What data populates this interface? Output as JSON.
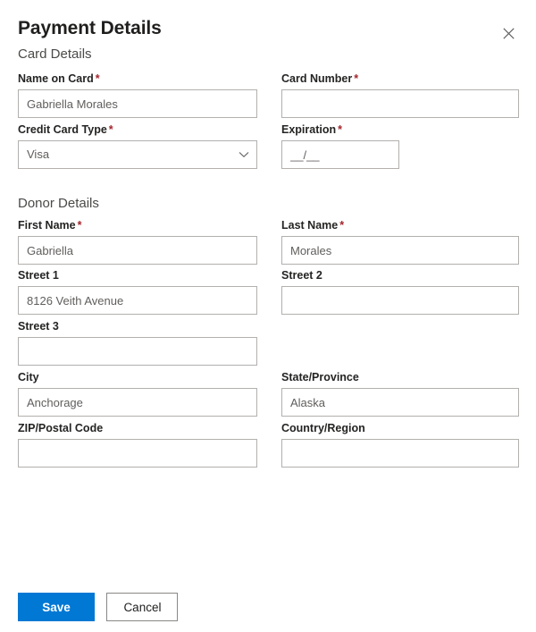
{
  "dialog": {
    "title": "Payment Details",
    "close_icon": "close-icon"
  },
  "sections": {
    "card": {
      "heading": "Card Details"
    },
    "donor": {
      "heading": "Donor Details"
    }
  },
  "fields": {
    "name_on_card": {
      "label": "Name on Card",
      "required": "*",
      "value": "Gabriella Morales",
      "placeholder": ""
    },
    "card_number": {
      "label": "Card Number",
      "required": "*",
      "value": "",
      "placeholder": ""
    },
    "card_type": {
      "label": "Credit Card Type",
      "required": "*",
      "value": "Visa",
      "chevron_icon": "chevron-down-icon"
    },
    "expiration": {
      "label": "Expiration",
      "required": "*",
      "value": "__/__",
      "placeholder": "__/__"
    },
    "first_name": {
      "label": "First Name",
      "required": "*",
      "value": "Gabriella",
      "placeholder": ""
    },
    "last_name": {
      "label": "Last Name",
      "required": "*",
      "value": "Morales",
      "placeholder": ""
    },
    "street1": {
      "label": "Street 1",
      "required": "",
      "value": "8126 Veith Avenue",
      "placeholder": ""
    },
    "street2": {
      "label": "Street 2",
      "required": "",
      "value": "",
      "placeholder": ""
    },
    "street3": {
      "label": "Street 3",
      "required": "",
      "value": "",
      "placeholder": ""
    },
    "city": {
      "label": "City",
      "required": "",
      "value": "Anchorage",
      "placeholder": ""
    },
    "state": {
      "label": "State/Province",
      "required": "",
      "value": "Alaska",
      "placeholder": ""
    },
    "zip": {
      "label": "ZIP/Postal Code",
      "required": "",
      "value": "",
      "placeholder": ""
    },
    "country": {
      "label": "Country/Region",
      "required": "",
      "value": "",
      "placeholder": ""
    }
  },
  "footer": {
    "save_label": "Save",
    "cancel_label": "Cancel"
  },
  "colors": {
    "primary": "#0078d4",
    "required_asterisk": "#a4262c",
    "border": "#b3b0ad",
    "text": "#201f1e",
    "muted_text": "#605e5c"
  }
}
